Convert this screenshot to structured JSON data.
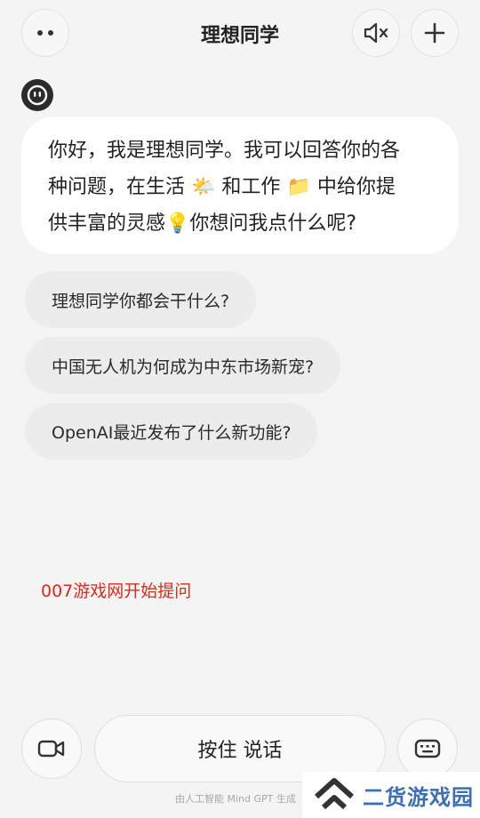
{
  "header": {
    "title": "理想同学",
    "more_icon": "more-dots-icon",
    "mute_icon": "speaker-muted-icon",
    "add_icon": "plus-icon"
  },
  "chat": {
    "assistant_avatar_icon": "assistant-face-icon",
    "greeting_line1": "你好，我是理想同学。我可以回答你的各",
    "greeting_line2_a": "种问题，在生活",
    "greeting_line2_b": "和工作",
    "greeting_line2_c": "中给你提",
    "greeting_line3_a": "供丰富的灵感",
    "greeting_line3_b": "你想问我点什么呢?",
    "emoji_life": "🌤️",
    "emoji_work": "📁",
    "emoji_idea": "💡"
  },
  "suggestions": [
    "理想同学你都会干什么?",
    "中国无人机为何成为中东市场新宠?",
    "OpenAI最近发布了什么新功能?"
  ],
  "watermark_text": "007游戏网开始提问",
  "bottom_bar": {
    "video_icon": "video-camera-icon",
    "talk_label": "按住 说话",
    "keyboard_icon": "keyboard-icon",
    "footer_note": "由人工智能 Mind GPT 生成"
  },
  "site_badge": {
    "icon": "double-chevron-up-icon",
    "text": "二货游戏园"
  },
  "colors": {
    "background": "#f4f4f4",
    "bubble": "#ffffff",
    "suggestion": "#ececec",
    "watermark_red": "#e0291b",
    "badge_blue": "#3d6fb5"
  }
}
